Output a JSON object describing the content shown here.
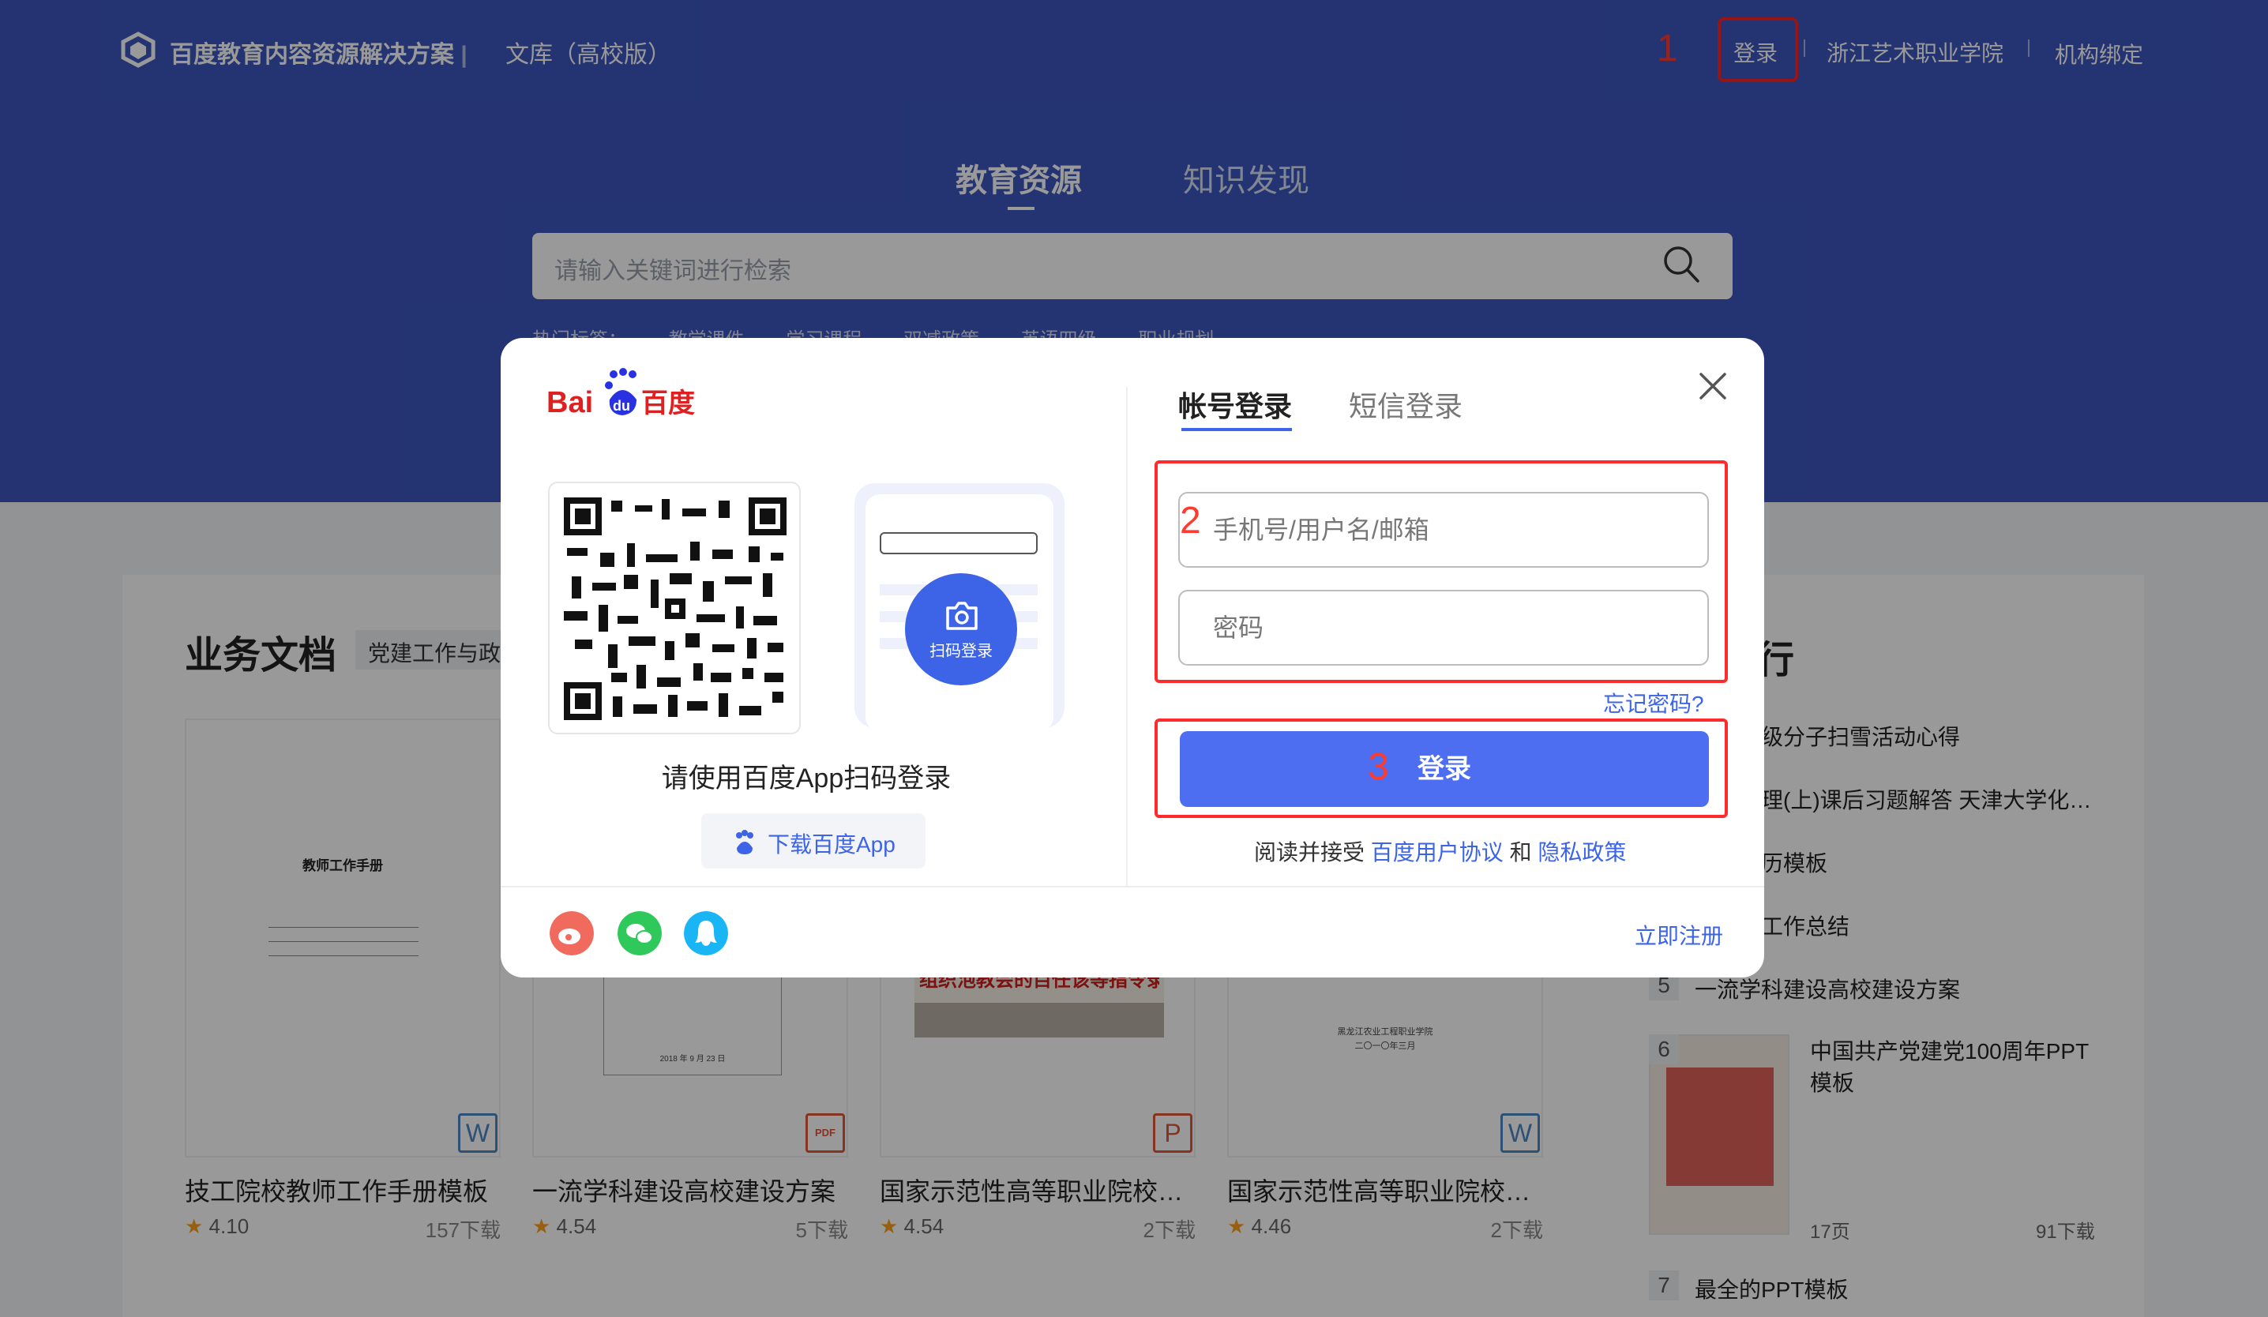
{
  "header": {
    "brand": "百度教育内容资源解决方案",
    "separator": "|",
    "subtitle": "文库（高校版）",
    "annotation_1": "1",
    "login": "登录",
    "school": "浙江艺术职业学院",
    "bind": "机构绑定"
  },
  "hero": {
    "tabs": [
      {
        "label": "教育资源"
      },
      {
        "label": "知识发现"
      }
    ],
    "search_placeholder": "请输入关键词进行检索",
    "hot_tags": [
      "热门标签：",
      "教学课件",
      "学习课程",
      "双减政策",
      "英语四级",
      "职业规划"
    ]
  },
  "content": {
    "section_title": "业务文档",
    "section_tag": "党建工作与政",
    "docs": [
      {
        "title": "技工院校教师工作手册模板",
        "rating": "4.10",
        "downloads": "157下载",
        "type": "W",
        "cover_title": "教师工作手册"
      },
      {
        "title": "一流学科建设高校建设方案",
        "rating": "4.54",
        "downloads": "5下载",
        "type": "PDF",
        "cover_date": "2018 年 9 月 23 日"
      },
      {
        "title": "国家示范性高等职业院校…",
        "rating": "4.54",
        "downloads": "2下载",
        "type": "P",
        "cover_banner": "组织泡教会的目任该等指令录！"
      },
      {
        "title": "国家示范性高等职业院校…",
        "rating": "4.46",
        "downloads": "2下载",
        "type": "W",
        "cover_title": "黑龙江农业工程职业学院",
        "cover_date": "二〇一〇年三月"
      }
    ],
    "rank_title": "行",
    "rank_items": [
      {
        "text": "级分子扫雪活动心得"
      },
      {
        "text": "理(上)课后习题解答 天津大学化…"
      },
      {
        "text": "历模板"
      },
      {
        "text": "工作总结"
      },
      {
        "num": "5",
        "text": "一流学科建设高校建设方案"
      },
      {
        "num": "6",
        "text": "中国共产党建党100周年PPT模板",
        "pages": "17页",
        "downloads": "91下载"
      },
      {
        "num": "7",
        "text": "最全的PPT模板"
      }
    ]
  },
  "modal": {
    "qr_hint": "请使用百度App扫码登录",
    "download_app": "下载百度App",
    "scan_label": "扫码登录",
    "tabs": {
      "account": "帐号登录",
      "sms": "短信登录"
    },
    "annotation_2": "2",
    "annotation_3": "3",
    "username_placeholder": "手机号/用户名/邮箱",
    "password_placeholder": "密码",
    "forgot": "忘记密码?",
    "login_button": "登录",
    "agree_prefix": "阅读并接受",
    "user_agreement": "百度用户协议",
    "and": "和",
    "privacy": "隐私政策",
    "register": "立即注册"
  },
  "colors": {
    "brand_blue": "#3d55be",
    "accent": "#4d6ef0",
    "annotation_red": "#ff2a2a"
  }
}
